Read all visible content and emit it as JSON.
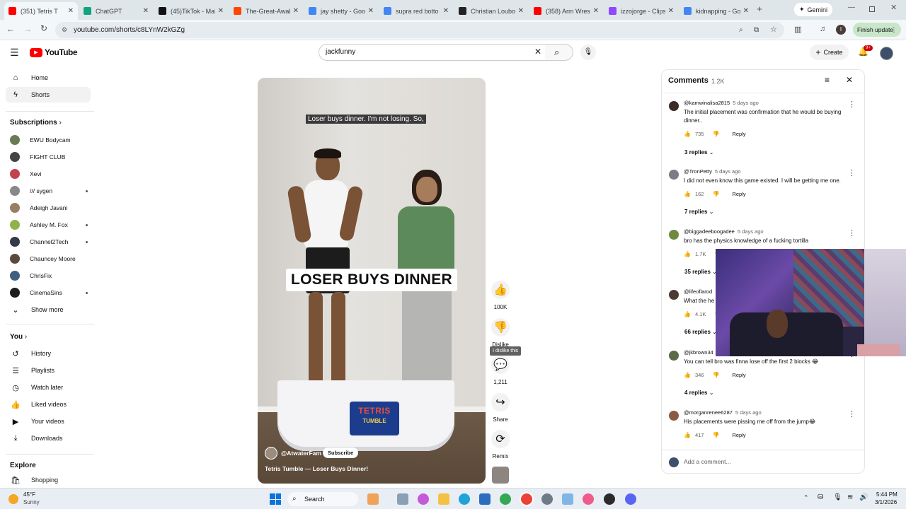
{
  "browser": {
    "tabs": [
      {
        "title": "(351) Tetris T",
        "fav": "#ff0000",
        "active": true
      },
      {
        "title": "ChatGPT",
        "fav": "#10a37f"
      },
      {
        "title": "(45)TikTok - Mak",
        "fav": "#111111"
      },
      {
        "title": "The-Great-Awak",
        "fav": "#ff4500"
      },
      {
        "title": "jay shetty - Goo",
        "fav": "#4285f4"
      },
      {
        "title": "supra red botto",
        "fav": "#4285f4"
      },
      {
        "title": "Christian Loubo",
        "fav": "#222222"
      },
      {
        "title": "(358) Arm Wrest",
        "fav": "#ff0000"
      },
      {
        "title": "izzojorge - Clips",
        "fav": "#9146ff"
      },
      {
        "title": "kidnapping - Go",
        "fav": "#4285f4"
      }
    ],
    "new_tab": "+",
    "gemini_label": "Gemini",
    "url": "youtube.com/shorts/c8LYnW2kGZg",
    "finish_update": "Finish update",
    "profile_initial": "I"
  },
  "youtube": {
    "logo_text": "YouTube",
    "search_value": "jackfunny",
    "create_label": "Create",
    "notif_badge": "9+"
  },
  "sidebar": {
    "main": [
      {
        "label": "Home",
        "icon": "home-icon",
        "glyph": "⌂"
      },
      {
        "label": "Shorts",
        "icon": "shorts-icon",
        "glyph": "ϟ",
        "active": true
      }
    ],
    "subscriptions_title": "Subscriptions",
    "subscriptions": [
      {
        "label": "EWU Bodycam",
        "color": "#6a7a55",
        "dot": false
      },
      {
        "label": "FIGHT CLUB",
        "color": "#444444",
        "dot": false
      },
      {
        "label": "Xevi",
        "color": "#c2434f",
        "dot": false
      },
      {
        "label": "/// sygen",
        "color": "#888888",
        "dot": true
      },
      {
        "label": "Adeigh Javani",
        "color": "#9b7d63",
        "dot": false
      },
      {
        "label": "Ashley M. Fox",
        "color": "#8fb34a",
        "dot": true
      },
      {
        "label": "Channel2Tech",
        "color": "#333a45",
        "dot": true
      },
      {
        "label": "Chauncey Moore",
        "color": "#5b4a3c",
        "dot": false
      },
      {
        "label": "ChrisFix",
        "color": "#3f5f7f",
        "dot": false
      },
      {
        "label": "CinemaSins",
        "color": "#1d1d1d",
        "dot": true
      }
    ],
    "show_more": "Show more",
    "you_title": "You",
    "you_items": [
      {
        "label": "History",
        "icon": "history-icon",
        "glyph": "↺"
      },
      {
        "label": "Playlists",
        "icon": "playlists-icon",
        "glyph": "☰"
      },
      {
        "label": "Watch later",
        "icon": "clock-icon",
        "glyph": "◷"
      },
      {
        "label": "Liked videos",
        "icon": "thumbs-up-icon",
        "glyph": "👍"
      },
      {
        "label": "Your videos",
        "icon": "video-icon",
        "glyph": "▶"
      },
      {
        "label": "Downloads",
        "icon": "download-icon",
        "glyph": "⤓"
      }
    ],
    "explore_title": "Explore",
    "explore_items": [
      {
        "label": "Shopping",
        "icon": "shopping-bag-icon",
        "glyph": "🛍"
      }
    ]
  },
  "short": {
    "caption_top": "Loser buys dinner. I'm not losing. So,",
    "caption_big": "LOSER BUYS DINNER",
    "channel": "@AtwaterFam",
    "subscribe": "Subscribe",
    "title": "Tetris Tumble — Loser Buys Dinner!",
    "game_word1": "TETRIS",
    "game_word2": "TUMBLE"
  },
  "actions": {
    "like_count": "100K",
    "dislike_label": "Dislike",
    "dislike_tooltip": "I dislike this",
    "comment_count": "1,211",
    "share_label": "Share",
    "remix_label": "Remix"
  },
  "comments_panel": {
    "title": "Comments",
    "count": "1.2K",
    "add_placeholder": "Add a comment...",
    "reply_label": "Reply",
    "comments": [
      {
        "user": "@kamwinalisa2815",
        "time": "5 days ago",
        "text": "The initial placement was confirmation that he would be buying dinner..",
        "likes": "735",
        "replies": "3 replies",
        "color": "#3a2d28"
      },
      {
        "user": "@TronPetty",
        "time": "5 days ago",
        "text": "I did not even know this game existed. I will be getting me one.",
        "likes": "162",
        "replies": "7 replies",
        "color": "#7a7d84"
      },
      {
        "user": "@biggadeeboogadee",
        "time": "5 days ago",
        "text": "bro has the physics knowledge of a fucking tortilla",
        "likes": "1.7K",
        "replies": "35 replies",
        "color": "#6f8a3e"
      },
      {
        "user": "@lifeoflarod",
        "time": "",
        "text": "What the he",
        "likes": "4.1K",
        "replies": "66 replies",
        "color": "#4a3b35"
      },
      {
        "user": "@jkbrown34",
        "time": "",
        "text": "You can tell bro was finna lose off the first 2 blocks 😂",
        "likes": "346",
        "replies": "4 replies",
        "color": "#5b6b48"
      },
      {
        "user": "@morganrenee6287",
        "time": "5 days ago",
        "text": "His placements were pissing me off from the jump😂",
        "likes": "417",
        "replies": "",
        "color": "#8a5a44"
      }
    ]
  },
  "taskbar": {
    "temp": "45°F",
    "weather": "Sunny",
    "search_label": "Search",
    "time": "5:44 PM",
    "date": "3/1/2026"
  },
  "colors": {
    "accent_red": "#ff0000",
    "link_blue": "#065fd4",
    "update_green": "#c8e6c9"
  }
}
